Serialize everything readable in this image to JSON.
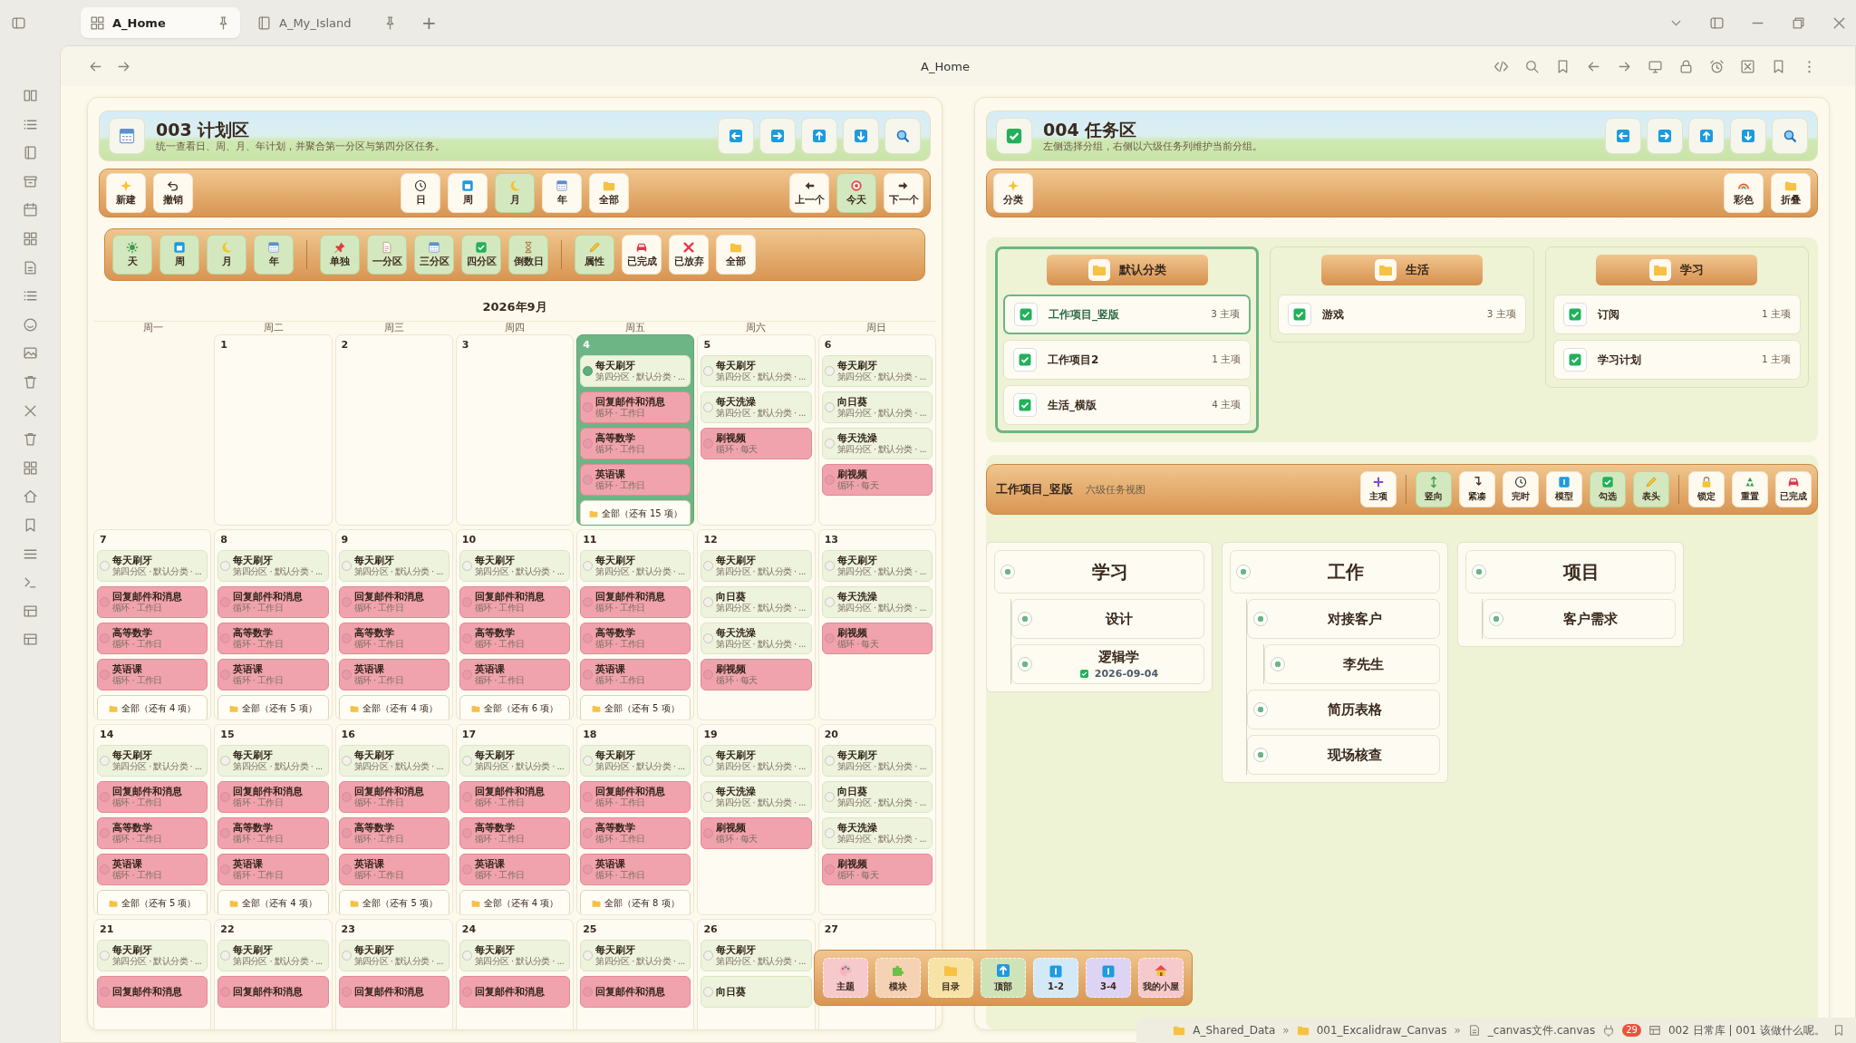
{
  "tabs": [
    {
      "label": "A_Home",
      "selected": true
    },
    {
      "label": "A_My_Island",
      "selected": false
    }
  ],
  "new_tab": "+",
  "nav_title": "A_Home",
  "planner": {
    "title": "003 计划区",
    "subtitle": "统一查看日、周、月、年计划，并聚合第一分区与第四分区任务。",
    "toolbar": [
      [
        {
          "label": "新建",
          "on": false
        },
        {
          "label": "撤销",
          "on": false
        }
      ],
      [
        {
          "label": "日",
          "on": false
        },
        {
          "label": "周",
          "on": false
        },
        {
          "label": "月",
          "on": true
        },
        {
          "label": "年",
          "on": false
        },
        {
          "label": "全部",
          "on": false
        }
      ],
      [
        {
          "label": "上一个",
          "on": false
        },
        {
          "label": "今天",
          "on": true
        },
        {
          "label": "下一个",
          "on": false
        }
      ]
    ],
    "filters": [
      [
        {
          "label": "天",
          "on": true
        },
        {
          "label": "周",
          "on": true
        },
        {
          "label": "月",
          "on": true
        },
        {
          "label": "年",
          "on": true
        }
      ],
      [
        {
          "label": "单独",
          "on": true
        },
        {
          "label": "一分区",
          "on": true
        },
        {
          "label": "三分区",
          "on": true
        },
        {
          "label": "四分区",
          "on": true
        },
        {
          "label": "倒数日",
          "on": true
        }
      ],
      [
        {
          "label": "属性",
          "on": true
        },
        {
          "label": "已完成",
          "on": false
        },
        {
          "label": "已放弃",
          "on": false
        },
        {
          "label": "全部",
          "on": false
        }
      ]
    ],
    "calendar": {
      "month": "2026年9月",
      "weekdays": [
        "周一",
        "周二",
        "周三",
        "周四",
        "周五",
        "周六",
        "周日"
      ],
      "weeks": [
        [
          {
            "kind": "blank"
          },
          {
            "kind": "day",
            "day": "1",
            "today": false
          },
          {
            "kind": "day",
            "day": "2",
            "today": false
          },
          {
            "kind": "day",
            "day": "3",
            "today": false
          },
          {
            "kind": "day",
            "day": "4",
            "today": true,
            "more": "全部（还有 15 项）",
            "tasks": [
              {
                "title": "每天刷牙",
                "sub": "第四分区 · 默认分类 · ...",
                "kind": "routine",
                "checked": true
              },
              {
                "title": "回复邮件和消息",
                "sub": "循环 · 工作日",
                "kind": "recurring",
                "checked": false
              },
              {
                "title": "高等数学",
                "sub": "循环 · 工作日",
                "kind": "recurring",
                "checked": false
              },
              {
                "title": "英语课",
                "sub": "循环 · 工作日",
                "kind": "recurring",
                "checked": false
              }
            ]
          },
          {
            "kind": "day",
            "day": "5",
            "today": false,
            "tasks": [
              {
                "title": "每天刷牙",
                "sub": "第四分区 · 默认分类 · ...",
                "kind": "routine",
                "checked": false
              },
              {
                "title": "每天洗澡",
                "sub": "第四分区 · 默认分类 · ...",
                "kind": "routine",
                "checked": false
              },
              {
                "title": "刷视频",
                "sub": "循环 · 每天",
                "kind": "recurring",
                "checked": false
              }
            ]
          },
          {
            "kind": "day",
            "day": "6",
            "today": false,
            "tasks": [
              {
                "title": "每天刷牙",
                "sub": "第四分区 · 默认分类 · ...",
                "kind": "routine",
                "checked": false
              },
              {
                "title": "向日葵",
                "sub": "第四分区 · 默认分类 · ...",
                "kind": "routine",
                "checked": false
              },
              {
                "title": "每天洗澡",
                "sub": "第四分区 · 默认分类 · ...",
                "kind": "routine",
                "checked": false
              },
              {
                "title": "刷视频",
                "sub": "循环 · 每天",
                "kind": "recurring",
                "checked": false
              }
            ]
          }
        ],
        [
          {
            "kind": "day",
            "day": "7",
            "today": false,
            "more": "全部（还有 4 项）",
            "tasks": [
              {
                "title": "每天刷牙",
                "sub": "第四分区 · 默认分类 · ...",
                "kind": "routine",
                "checked": false
              },
              {
                "title": "回复邮件和消息",
                "sub": "循环 · 工作日",
                "kind": "recurring",
                "checked": false
              },
              {
                "title": "高等数学",
                "sub": "循环 · 工作日",
                "kind": "recurring",
                "checked": false
              },
              {
                "title": "英语课",
                "sub": "循环 · 工作日",
                "kind": "recurring",
                "checked": false
              }
            ]
          },
          {
            "kind": "day",
            "day": "8",
            "today": false,
            "more": "全部（还有 5 项）",
            "tasks": [
              {
                "title": "每天刷牙",
                "sub": "第四分区 · 默认分类 · ...",
                "kind": "routine",
                "checked": false
              },
              {
                "title": "回复邮件和消息",
                "sub": "循环 · 工作日",
                "kind": "recurring",
                "checked": false
              },
              {
                "title": "高等数学",
                "sub": "循环 · 工作日",
                "kind": "recurring",
                "checked": false
              },
              {
                "title": "英语课",
                "sub": "循环 · 工作日",
                "kind": "recurring",
                "checked": false
              }
            ]
          },
          {
            "kind": "day",
            "day": "9",
            "today": false,
            "more": "全部（还有 4 项）",
            "tasks": [
              {
                "title": "每天刷牙",
                "sub": "第四分区 · 默认分类 · ...",
                "kind": "routine",
                "checked": false
              },
              {
                "title": "回复邮件和消息",
                "sub": "循环 · 工作日",
                "kind": "recurring",
                "checked": false
              },
              {
                "title": "高等数学",
                "sub": "循环 · 工作日",
                "kind": "recurring",
                "checked": false
              },
              {
                "title": "英语课",
                "sub": "循环 · 工作日",
                "kind": "recurring",
                "checked": false
              }
            ]
          },
          {
            "kind": "day",
            "day": "10",
            "today": false,
            "more": "全部（还有 6 项）",
            "tasks": [
              {
                "title": "每天刷牙",
                "sub": "第四分区 · 默认分类 · ...",
                "kind": "routine",
                "checked": false
              },
              {
                "title": "回复邮件和消息",
                "sub": "循环 · 工作日",
                "kind": "recurring",
                "checked": false
              },
              {
                "title": "高等数学",
                "sub": "循环 · 工作日",
                "kind": "recurring",
                "checked": false
              },
              {
                "title": "英语课",
                "sub": "循环 · 工作日",
                "kind": "recurring",
                "checked": false
              }
            ]
          },
          {
            "kind": "day",
            "day": "11",
            "today": false,
            "more": "全部（还有 5 项）",
            "tasks": [
              {
                "title": "每天刷牙",
                "sub": "第四分区 · 默认分类 · ...",
                "kind": "routine",
                "checked": false
              },
              {
                "title": "回复邮件和消息",
                "sub": "循环 · 工作日",
                "kind": "recurring",
                "checked": false
              },
              {
                "title": "高等数学",
                "sub": "循环 · 工作日",
                "kind": "recurring",
                "checked": false
              },
              {
                "title": "英语课",
                "sub": "循环 · 工作日",
                "kind": "recurring",
                "checked": false
              }
            ]
          },
          {
            "kind": "day",
            "day": "12",
            "today": false,
            "tasks": [
              {
                "title": "每天刷牙",
                "sub": "第四分区 · 默认分类 · ...",
                "kind": "routine",
                "checked": false
              },
              {
                "title": "向日葵",
                "sub": "第四分区 · 默认分类 · ...",
                "kind": "routine",
                "checked": false
              },
              {
                "title": "每天洗澡",
                "sub": "第四分区 · 默认分类 · ...",
                "kind": "routine",
                "checked": false
              },
              {
                "title": "刷视频",
                "sub": "循环 · 每天",
                "kind": "recurring",
                "checked": false
              }
            ]
          },
          {
            "kind": "day",
            "day": "13",
            "today": false,
            "tasks": [
              {
                "title": "每天刷牙",
                "sub": "第四分区 · 默认分类 · ...",
                "kind": "routine",
                "checked": false
              },
              {
                "title": "每天洗澡",
                "sub": "第四分区 · 默认分类 · ...",
                "kind": "routine",
                "checked": false
              },
              {
                "title": "刷视频",
                "sub": "循环 · 每天",
                "kind": "recurring",
                "checked": false
              }
            ]
          }
        ],
        [
          {
            "kind": "day",
            "day": "14",
            "today": false,
            "more": "全部（还有 5 项）",
            "tasks": [
              {
                "title": "每天刷牙",
                "sub": "第四分区 · 默认分类 · ...",
                "kind": "routine",
                "checked": false
              },
              {
                "title": "回复邮件和消息",
                "sub": "循环 · 工作日",
                "kind": "recurring",
                "checked": false
              },
              {
                "title": "高等数学",
                "sub": "循环 · 工作日",
                "kind": "recurring",
                "checked": false
              },
              {
                "title": "英语课",
                "sub": "循环 · 工作日",
                "kind": "recurring",
                "checked": false
              }
            ]
          },
          {
            "kind": "day",
            "day": "15",
            "today": false,
            "more": "全部（还有 4 项）",
            "tasks": [
              {
                "title": "每天刷牙",
                "sub": "第四分区 · 默认分类 · ...",
                "kind": "routine",
                "checked": false
              },
              {
                "title": "回复邮件和消息",
                "sub": "循环 · 工作日",
                "kind": "recurring",
                "checked": false
              },
              {
                "title": "高等数学",
                "sub": "循环 · 工作日",
                "kind": "recurring",
                "checked": false
              },
              {
                "title": "英语课",
                "sub": "循环 · 工作日",
                "kind": "recurring",
                "checked": false
              }
            ]
          },
          {
            "kind": "day",
            "day": "16",
            "today": false,
            "more": "全部（还有 5 项）",
            "tasks": [
              {
                "title": "每天刷牙",
                "sub": "第四分区 · 默认分类 · ...",
                "kind": "routine",
                "checked": false
              },
              {
                "title": "回复邮件和消息",
                "sub": "循环 · 工作日",
                "kind": "recurring",
                "checked": false
              },
              {
                "title": "高等数学",
                "sub": "循环 · 工作日",
                "kind": "recurring",
                "checked": false
              },
              {
                "title": "英语课",
                "sub": "循环 · 工作日",
                "kind": "recurring",
                "checked": false
              }
            ]
          },
          {
            "kind": "day",
            "day": "17",
            "today": false,
            "more": "全部（还有 4 项）",
            "tasks": [
              {
                "title": "每天刷牙",
                "sub": "第四分区 · 默认分类 · ...",
                "kind": "routine",
                "checked": false
              },
              {
                "title": "回复邮件和消息",
                "sub": "循环 · 工作日",
                "kind": "recurring",
                "checked": false
              },
              {
                "title": "高等数学",
                "sub": "循环 · 工作日",
                "kind": "recurring",
                "checked": false
              },
              {
                "title": "英语课",
                "sub": "循环 · 工作日",
                "kind": "recurring",
                "checked": false
              }
            ]
          },
          {
            "kind": "day",
            "day": "18",
            "today": false,
            "more": "全部（还有 8 项）",
            "tasks": [
              {
                "title": "每天刷牙",
                "sub": "第四分区 · 默认分类 · ...",
                "kind": "routine",
                "checked": false
              },
              {
                "title": "回复邮件和消息",
                "sub": "循环 · 工作日",
                "kind": "recurring",
                "checked": false
              },
              {
                "title": "高等数学",
                "sub": "循环 · 工作日",
                "kind": "recurring",
                "checked": false
              },
              {
                "title": "英语课",
                "sub": "循环 · 工作日",
                "kind": "recurring",
                "checked": false
              }
            ]
          },
          {
            "kind": "day",
            "day": "19",
            "today": false,
            "tasks": [
              {
                "title": "每天刷牙",
                "sub": "第四分区 · 默认分类 · ...",
                "kind": "routine",
                "checked": false
              },
              {
                "title": "每天洗澡",
                "sub": "第四分区 · 默认分类 · ...",
                "kind": "routine",
                "checked": false
              },
              {
                "title": "刷视频",
                "sub": "循环 · 每天",
                "kind": "recurring",
                "checked": false
              }
            ]
          },
          {
            "kind": "day",
            "day": "20",
            "today": false,
            "tasks": [
              {
                "title": "每天刷牙",
                "sub": "第四分区 · 默认分类 · ...",
                "kind": "routine",
                "checked": false
              },
              {
                "title": "向日葵",
                "sub": "第四分区 · 默认分类 · ...",
                "kind": "routine",
                "checked": false
              },
              {
                "title": "每天洗澡",
                "sub": "第四分区 · 默认分类 · ...",
                "kind": "routine",
                "checked": false
              },
              {
                "title": "刷视频",
                "sub": "循环 · 每天",
                "kind": "recurring",
                "checked": false
              }
            ]
          }
        ],
        [
          {
            "kind": "day",
            "day": "21",
            "today": false,
            "tasks": [
              {
                "title": "每天刷牙",
                "sub": "第四分区 · 默认分类 · ...",
                "kind": "routine",
                "checked": false
              },
              {
                "title": "回复邮件和消息",
                "kind": "recurring",
                "checked": false
              }
            ]
          },
          {
            "kind": "day",
            "day": "22",
            "today": false,
            "tasks": [
              {
                "title": "每天刷牙",
                "sub": "第四分区 · 默认分类 · ...",
                "kind": "routine",
                "checked": false
              },
              {
                "title": "回复邮件和消息",
                "kind": "recurring",
                "checked": false
              }
            ]
          },
          {
            "kind": "day",
            "day": "23",
            "today": false,
            "tasks": [
              {
                "title": "每天刷牙",
                "sub": "第四分区 · 默认分类 · ...",
                "kind": "routine",
                "checked": false
              },
              {
                "title": "回复邮件和消息",
                "kind": "recurring",
                "checked": false
              }
            ]
          },
          {
            "kind": "day",
            "day": "24",
            "today": false,
            "tasks": [
              {
                "title": "每天刷牙",
                "sub": "第四分区 · 默认分类 · ...",
                "kind": "routine",
                "checked": false
              },
              {
                "title": "回复邮件和消息",
                "kind": "recurring",
                "checked": false
              }
            ]
          },
          {
            "kind": "day",
            "day": "25",
            "today": false,
            "tasks": [
              {
                "title": "每天刷牙",
                "sub": "第四分区 · 默认分类 · ...",
                "kind": "routine",
                "checked": false
              },
              {
                "title": "回复邮件和消息",
                "kind": "recurring",
                "checked": false
              }
            ]
          },
          {
            "kind": "day",
            "day": "26",
            "today": false,
            "tasks": [
              {
                "title": "每天刷牙",
                "sub": "第四分区 · 默认分类 · ...",
                "kind": "routine",
                "checked": false
              },
              {
                "title": "向日葵",
                "kind": "routine",
                "checked": false
              }
            ]
          },
          {
            "kind": "day",
            "day": "27",
            "today": false
          }
        ]
      ]
    }
  },
  "taskzone": {
    "title": "004 任务区",
    "subtitle": "左侧选择分组，右侧以六级任务列维护当前分组。",
    "toolbar": [
      [
        {
          "label": "分类",
          "on": false
        }
      ],
      [
        {
          "label": "彩色",
          "on": false
        },
        {
          "label": "折叠",
          "on": false
        }
      ]
    ],
    "groups": [
      {
        "name": "默认分类",
        "selected": true,
        "items": [
          {
            "name": "工作项目_竖版",
            "count": "3 主项",
            "selected": true
          },
          {
            "name": "工作项目2",
            "count": "1 主项",
            "selected": false
          },
          {
            "name": "生活_横版",
            "count": "4 主项",
            "selected": false
          }
        ]
      },
      {
        "name": "生活",
        "selected": false,
        "items": [
          {
            "name": "游戏",
            "count": "3 主项",
            "selected": false
          }
        ]
      },
      {
        "name": "学习",
        "selected": false,
        "items": [
          {
            "name": "订阅",
            "count": "1 主项",
            "selected": false
          },
          {
            "name": "学习计划",
            "count": "1 主项",
            "selected": false
          }
        ]
      }
    ],
    "board": {
      "title": "工作项目_竖版",
      "subtitle": "六级任务视图",
      "toolbar": [
        [
          {
            "label": "主项",
            "on": false
          }
        ],
        [
          {
            "label": "竖向",
            "on": true
          },
          {
            "label": "紧凑",
            "on": false
          },
          {
            "label": "完时",
            "on": false
          },
          {
            "label": "模型",
            "on": false
          },
          {
            "label": "勾选",
            "on": true
          },
          {
            "label": "表头",
            "on": true
          }
        ],
        [
          {
            "label": "锁定",
            "on": false
          },
          {
            "label": "重置",
            "on": false
          },
          {
            "label": "已完成",
            "on": false
          }
        ]
      ],
      "columns": [
        {
          "title": "学习",
          "children": [
            {
              "title": "设计"
            },
            {
              "title": "逻辑学",
              "due": {
                "date": "2026-09-04",
                "checked": true
              }
            }
          ]
        },
        {
          "title": "工作",
          "children": [
            {
              "title": "对接客户",
              "children": [
                {
                  "title": "李先生"
                }
              ]
            },
            {
              "title": "简历表格"
            },
            {
              "title": "现场核查"
            }
          ]
        },
        {
          "title": "项目",
          "children": [
            {
              "title": "客户需求"
            }
          ]
        }
      ]
    }
  },
  "dock": [
    {
      "label": "主题",
      "color": "#f6c9cc"
    },
    {
      "label": "模块",
      "color": "#f5d2b4"
    },
    {
      "label": "目录",
      "color": "#f8e3a6"
    },
    {
      "label": "顶部",
      "color": "#cfe3b8"
    },
    {
      "label": "1-2",
      "color": "#d3e9f7"
    },
    {
      "label": "3-4",
      "color": "#ddd3f2"
    },
    {
      "label": "我的小屋",
      "color": "#f6c9cc"
    }
  ],
  "status_bar": {
    "crumbs": [
      {
        "kind": "folder",
        "label": "A_Shared_Data"
      },
      {
        "kind": "sep",
        "label": "»"
      },
      {
        "kind": "folder",
        "label": "001_Excalidraw_Canvas"
      },
      {
        "kind": "sep",
        "label": "»"
      },
      {
        "kind": "file",
        "label": "_canvas文件.canvas"
      }
    ],
    "badge": "29",
    "vault": "002 日常库 | 001 该做什么呢。"
  }
}
